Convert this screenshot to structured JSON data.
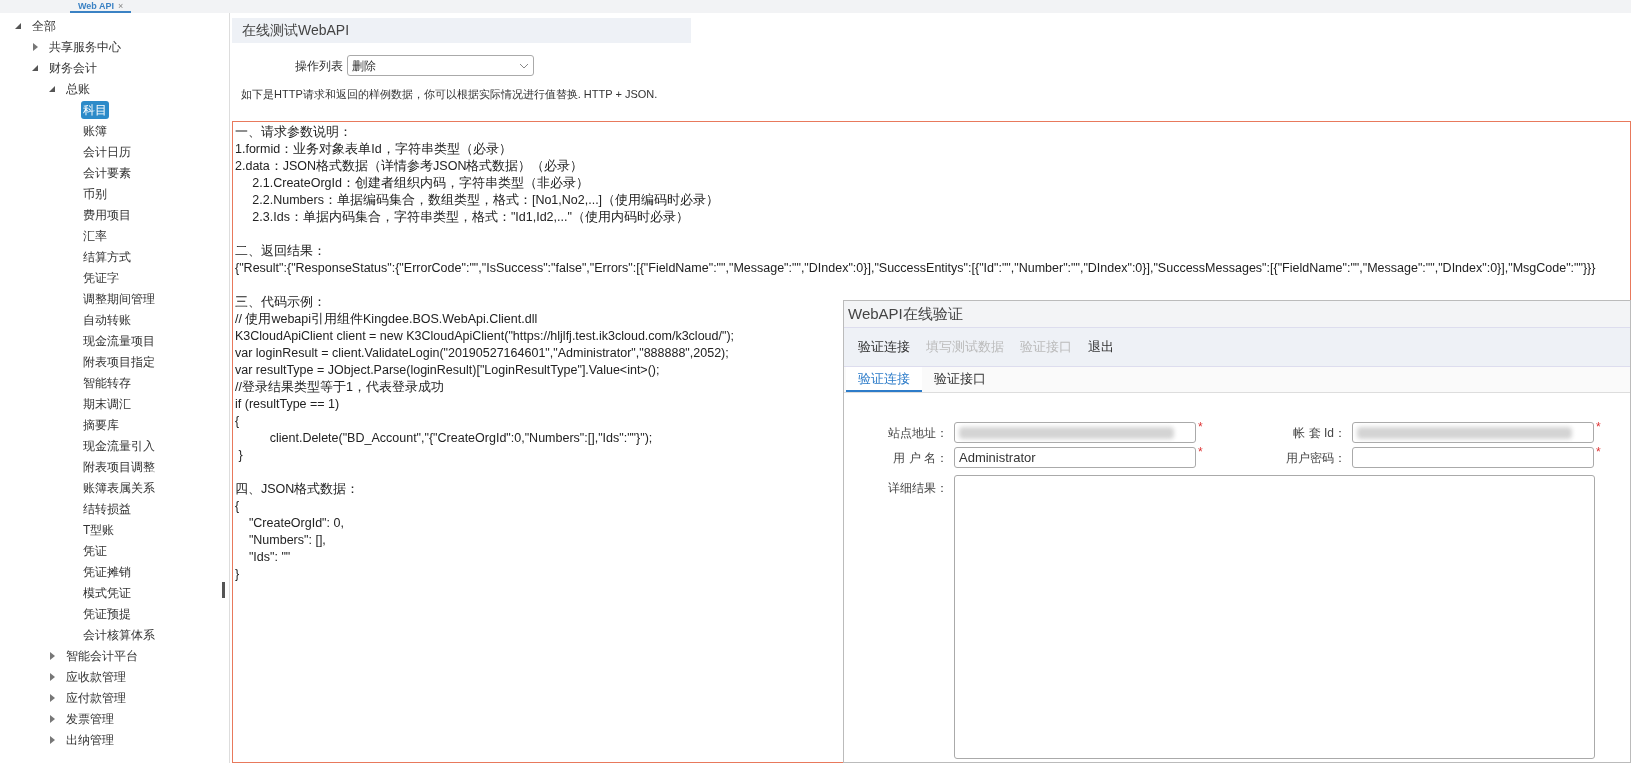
{
  "top_tab": {
    "label": "Web API",
    "close": "×"
  },
  "sidebar": {
    "tree": [
      {
        "label": "全部",
        "expanded": true,
        "selected": false,
        "children": [
          {
            "label": "共享服务中心",
            "expanded": false,
            "selected": false
          },
          {
            "label": "财务会计",
            "expanded": true,
            "selected": false,
            "children": [
              {
                "label": "总账",
                "expanded": true,
                "selected": false,
                "children": [
                  {
                    "label": "科目",
                    "selected": true
                  },
                  {
                    "label": "账簿",
                    "selected": false
                  },
                  {
                    "label": "会计日历",
                    "selected": false
                  },
                  {
                    "label": "会计要素",
                    "selected": false
                  },
                  {
                    "label": "币别",
                    "selected": false
                  },
                  {
                    "label": "费用项目",
                    "selected": false
                  },
                  {
                    "label": "汇率",
                    "selected": false
                  },
                  {
                    "label": "结算方式",
                    "selected": false
                  },
                  {
                    "label": "凭证字",
                    "selected": false
                  },
                  {
                    "label": "调整期间管理",
                    "selected": false
                  },
                  {
                    "label": "自动转账",
                    "selected": false
                  },
                  {
                    "label": "现金流量项目",
                    "selected": false
                  },
                  {
                    "label": "附表项目指定",
                    "selected": false
                  },
                  {
                    "label": "智能转存",
                    "selected": false
                  },
                  {
                    "label": "期末调汇",
                    "selected": false
                  },
                  {
                    "label": "摘要库",
                    "selected": false
                  },
                  {
                    "label": "现金流量引入",
                    "selected": false
                  },
                  {
                    "label": "附表项目调整",
                    "selected": false
                  },
                  {
                    "label": "账簿表属关系",
                    "selected": false
                  },
                  {
                    "label": "结转损益",
                    "selected": false
                  },
                  {
                    "label": "T型账",
                    "selected": false
                  },
                  {
                    "label": "凭证",
                    "selected": false
                  },
                  {
                    "label": "凭证摊销",
                    "selected": false
                  },
                  {
                    "label": "模式凭证",
                    "selected": false
                  },
                  {
                    "label": "凭证预提",
                    "selected": false
                  },
                  {
                    "label": "会计核算体系",
                    "selected": false
                  }
                ]
              },
              {
                "label": "智能会计平台",
                "expanded": false,
                "selected": false
              },
              {
                "label": "应收款管理",
                "expanded": false,
                "selected": false
              },
              {
                "label": "应付款管理",
                "expanded": false,
                "selected": false
              },
              {
                "label": "发票管理",
                "expanded": false,
                "selected": false
              },
              {
                "label": "出纳管理",
                "expanded": false,
                "selected": false
              }
            ]
          }
        ]
      }
    ]
  },
  "main": {
    "header_title": "在线测试WebAPI",
    "operation": {
      "label": "操作列表",
      "value": "删除"
    },
    "description": "如下是HTTP请求和返回的样例数据，你可以根据实际情况进行值替换. HTTP + JSON.",
    "code_blocks": [
      [
        "一、请求参数说明：",
        "1.formid：业务对象表单Id，字符串类型（必录）",
        "2.data：JSON格式数据（详情参考JSON格式数据）（必录）",
        "     2.1.CreateOrgId：创建者组织内码，字符串类型（非必录）",
        "     2.2.Numbers：单据编码集合，数组类型，格式：[No1,No2,...]（使用编码时必录）",
        "     2.3.Ids：单据内码集合，字符串类型，格式：\"Id1,Id2,...\"（使用内码时必录）"
      ],
      [
        "二、返回结果：",
        "{\"Result\":{\"ResponseStatus\":{\"ErrorCode\":\"\",\"IsSuccess\":\"false\",\"Errors\":[{\"FieldName\":\"\",\"Message\":\"\",\"DIndex\":0}],\"SuccessEntitys\":[{\"Id\":\"\",\"Number\":\"\",\"DIndex\":0}],\"SuccessMessages\":[{\"FieldName\":\"\",\"Message\":\"\",\"DIndex\":0}],\"MsgCode\":\"\"}}}"
      ],
      [
        "三、代码示例：",
        "// 使用webapi引用组件Kingdee.BOS.WebApi.Client.dll",
        "K3CloudApiClient client = new K3CloudApiClient(\"https://hljlfj.test.ik3cloud.com/k3cloud/\");",
        "var loginResult = client.ValidateLogin(\"20190527164601\",\"Administrator\",\"888888\",2052);",
        "var resultType = JObject.Parse(loginResult)[\"LoginResultType\"].Value<int>();",
        "//登录结果类型等于1，代表登录成功",
        "if (resultType == 1)",
        "{",
        "          client.Delete(\"BD_Account\",\"{\"CreateOrgId\":0,\"Numbers\":[],\"Ids\":\"\"}\");",
        " }"
      ],
      [
        "四、JSON格式数据：",
        "{",
        "    \"CreateOrgId\": 0,",
        "    \"Numbers\": [],",
        "    \"Ids\": \"\"",
        "}"
      ]
    ]
  },
  "dialog": {
    "title": "WebAPI在线验证",
    "toolbar": [
      {
        "label": "验证连接",
        "disabled": false
      },
      {
        "label": "填写测试数据",
        "disabled": true
      },
      {
        "label": "验证接口",
        "disabled": true
      },
      {
        "label": "退出",
        "disabled": false
      }
    ],
    "tabs": [
      {
        "label": "验证连接",
        "selected": true
      },
      {
        "label": "验证接口",
        "selected": false
      }
    ],
    "fields": [
      {
        "label": "站点地址：",
        "redacted": true,
        "required": true
      },
      {
        "label": "帐 套 Id：",
        "redacted": true,
        "required": true
      },
      {
        "label": "用 户 名：",
        "value": "Administrator",
        "required": true
      },
      {
        "label": "用户密码：",
        "required": true
      }
    ],
    "result": {
      "label": "详细结果："
    },
    "required_mark": "*"
  }
}
